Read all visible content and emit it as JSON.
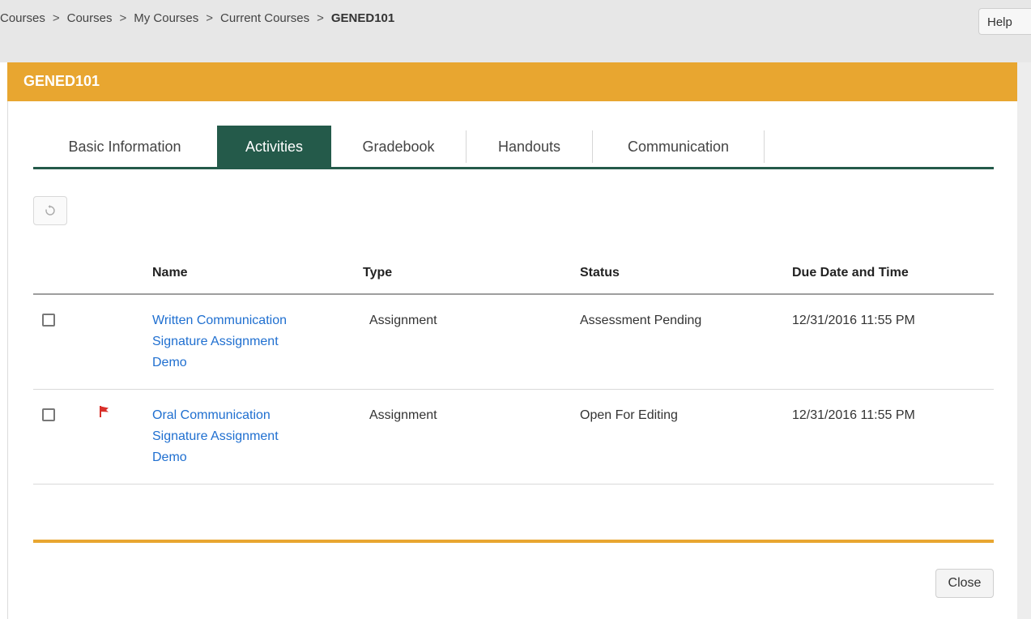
{
  "breadcrumb": {
    "items": [
      "Courses",
      "Courses",
      "My Courses",
      "Current Courses"
    ],
    "current": "GENED101",
    "separator": ">"
  },
  "header": {
    "help_label": "Help"
  },
  "course": {
    "title": "GENED101"
  },
  "tabs": [
    {
      "label": "Basic Information",
      "active": false
    },
    {
      "label": "Activities",
      "active": true
    },
    {
      "label": "Gradebook",
      "active": false
    },
    {
      "label": "Handouts",
      "active": false
    },
    {
      "label": "Communication",
      "active": false
    }
  ],
  "toolbar": {
    "refresh_icon": "refresh-icon"
  },
  "table": {
    "columns": [
      "Name",
      "Type",
      "Status",
      "Due Date and Time"
    ],
    "rows": [
      {
        "name_line1": "Written Communication",
        "name_line2": "Signature Assignment",
        "name_line3": "Demo",
        "type": "Assignment",
        "status": "Assessment Pending",
        "due": "12/31/2016 11:55 PM",
        "flagged": false
      },
      {
        "name_line1": "Oral Communication",
        "name_line2": "Signature Assignment",
        "name_line3": "Demo",
        "type": "Assignment",
        "status": "Open For Editing",
        "due": "12/31/2016 11:55 PM",
        "flagged": true
      }
    ]
  },
  "footer": {
    "close_label": "Close"
  },
  "colors": {
    "accent": "#e8a630",
    "tab_active": "#245a4a",
    "link": "#1f6fd0",
    "flag": "#d9302a"
  }
}
